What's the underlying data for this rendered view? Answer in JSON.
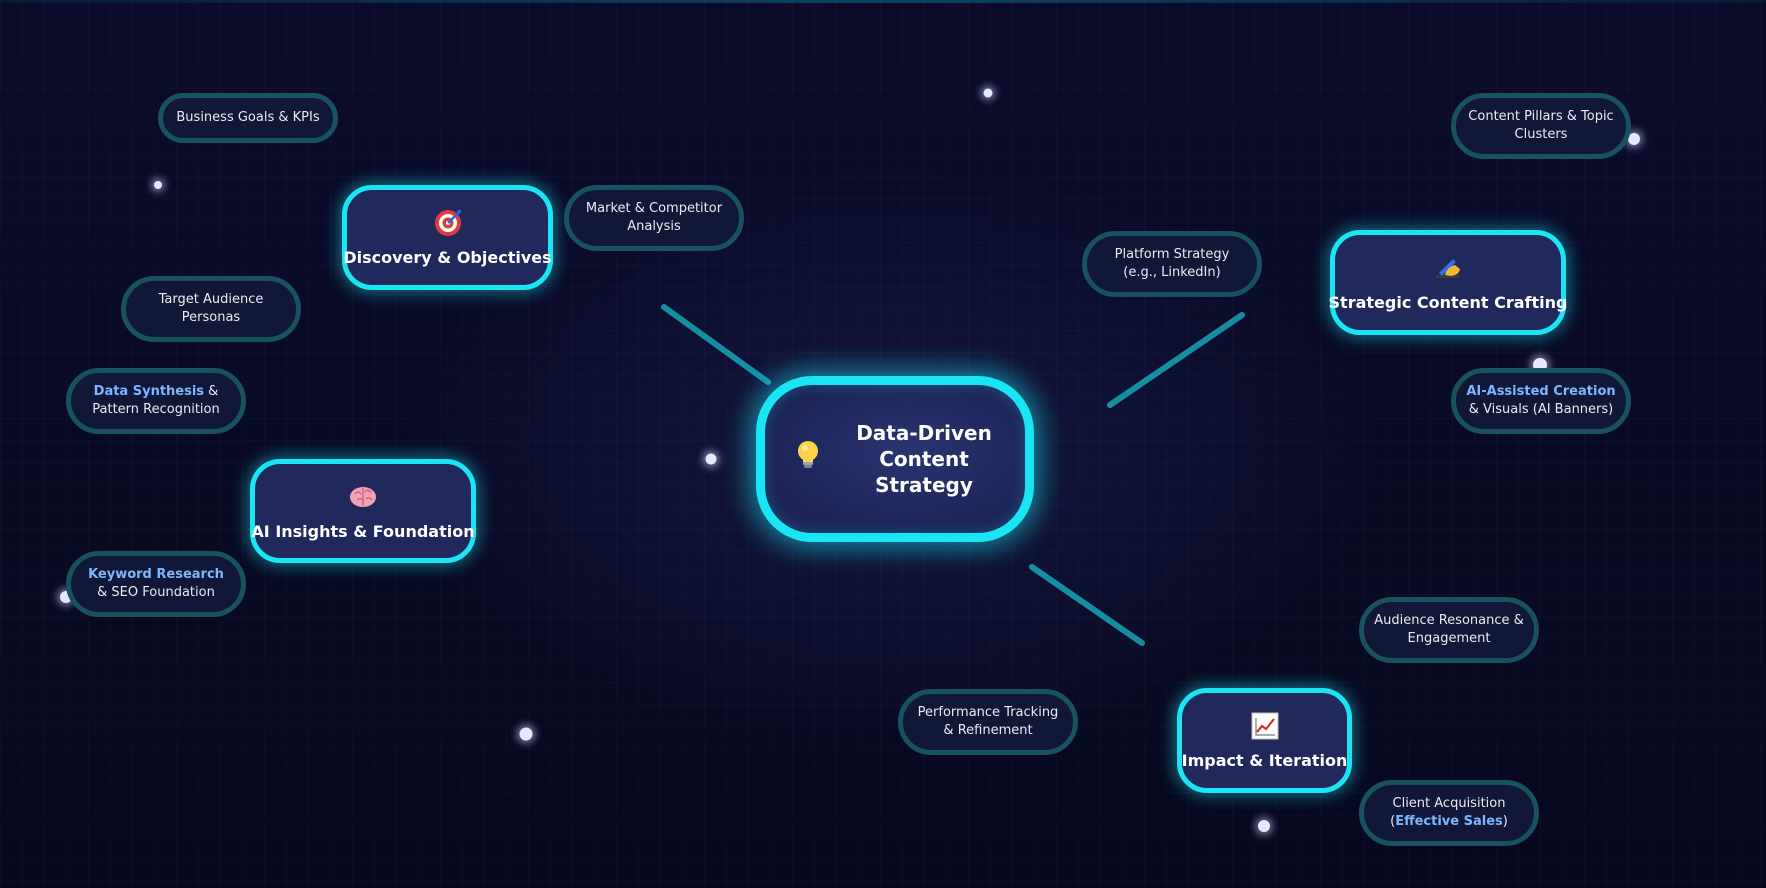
{
  "diagram": {
    "center": {
      "title": "Data-Driven Content Strategy",
      "icon": "lightbulb-icon"
    },
    "categories": [
      {
        "label": "Discovery & Objectives",
        "icon": "target-icon"
      },
      {
        "label": "AI Insights & Foundation",
        "icon": "brain-icon"
      },
      {
        "label": "Strategic Content Crafting",
        "icon": "writing-hand-icon"
      },
      {
        "label": "Impact & Iteration",
        "icon": "chart-increasing-icon"
      }
    ],
    "leaves": {
      "business_goals": "Business Goals & KPIs",
      "market_competitor": "Market & Competitor Analysis",
      "target_audience": "Target Audience Personas",
      "data_synthesis": {
        "highlight": "Data Synthesis",
        "rest": " & Pattern Recognition"
      },
      "keyword_research": {
        "highlight": "Keyword Research",
        "rest": " & SEO Foundation"
      },
      "content_pillars": "Content Pillars & Topic Clusters",
      "platform_strategy": "Platform Strategy (e.g., LinkedIn)",
      "ai_assisted": {
        "highlight": "AI-Assisted Creation",
        "rest": " & Visuals (AI Banners)"
      },
      "audience_resonance": "Audience Resonance & Engagement",
      "performance_tracking": "Performance Tracking & Refinement",
      "client_acquisition": {
        "prefix": "Client Acquisition (",
        "highlight": "Effective Sales",
        "suffix": ")"
      }
    },
    "colors": {
      "background": "#080a24",
      "node_border": "#19e6f2",
      "leaf_border": "#17525e",
      "node_fill": "#21285c",
      "highlight_text": "#7fb6ff"
    }
  }
}
